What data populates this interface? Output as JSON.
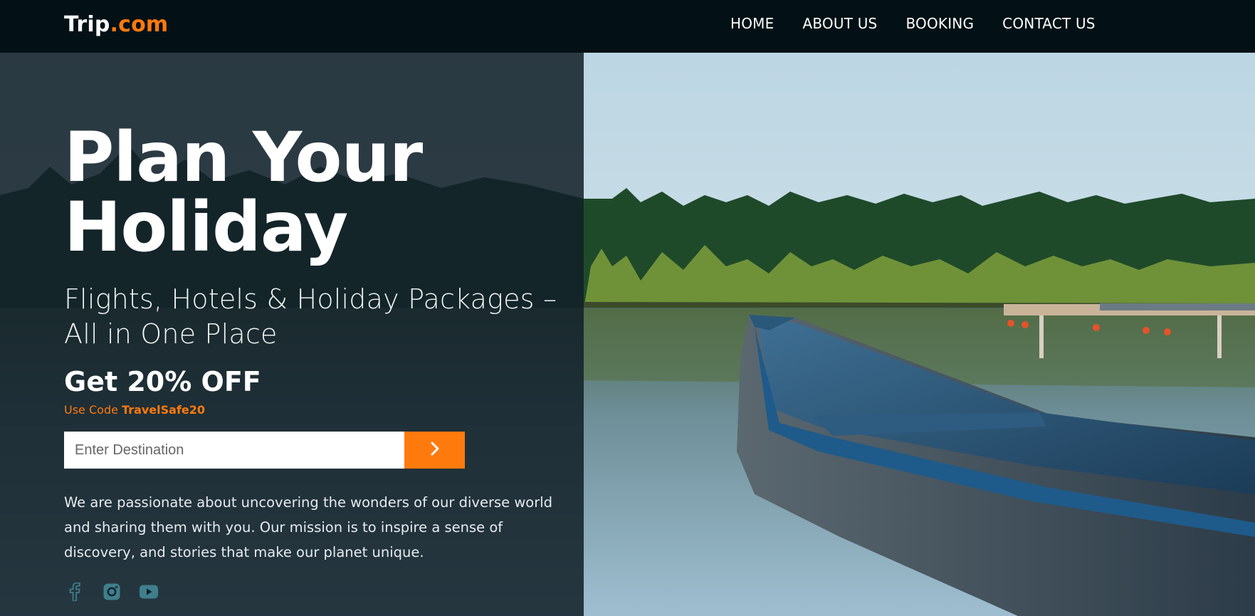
{
  "header": {
    "logo_main": "Trip",
    "logo_suffix": ".com",
    "nav": [
      "HOME",
      "ABOUT US",
      "BOOKING",
      "CONTACT US"
    ]
  },
  "hero": {
    "title_line1": "Plan Your",
    "title_line2": "Holiday",
    "subtitle_line1": "Flights, Hotels & Holiday Packages –",
    "subtitle_line2": "All in One Place",
    "offer": "Get 20% OFF",
    "code_prefix": "Use Code ",
    "code": "TravelSafe20",
    "search_placeholder": "Enter Destination",
    "description": "We are passionate about uncovering the wonders of our diverse world and sharing them with you. Our mission is to inspire a sense of discovery, and stories that make our planet unique."
  },
  "social_icons": [
    "facebook-icon",
    "instagram-icon",
    "youtube-icon"
  ],
  "colors": {
    "accent": "#ff7a0d",
    "header_bg": "#031116",
    "overlay": "#122028",
    "social_icon": "#3f7f8c"
  }
}
